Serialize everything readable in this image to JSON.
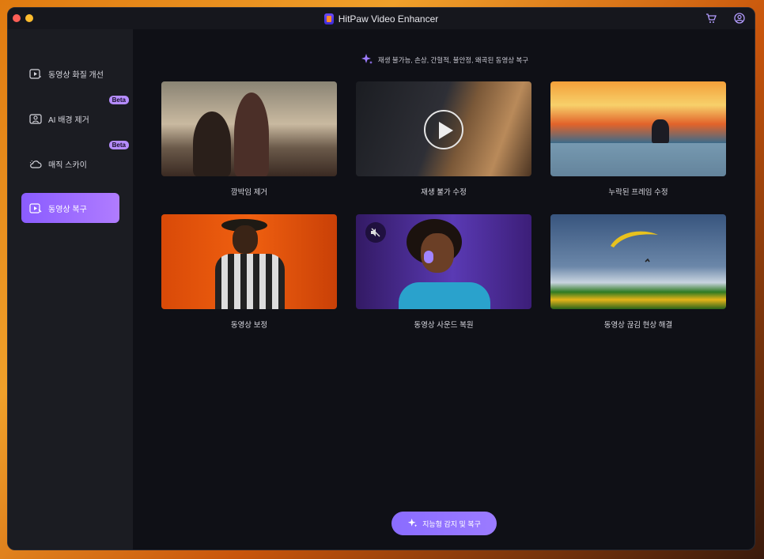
{
  "app": {
    "title": "HitPaw Video Enhancer"
  },
  "sidebar": {
    "items": [
      {
        "label": "동영상 화질 개선",
        "icon": "video-enhance-icon",
        "beta": ""
      },
      {
        "label": "AI 배경 제거",
        "icon": "ai-portrait-icon",
        "beta": "Beta"
      },
      {
        "label": "매직 스카이",
        "icon": "cloud-sky-icon",
        "beta": "Beta"
      },
      {
        "label": "동영상 복구",
        "icon": "video-repair-icon",
        "beta": ""
      }
    ]
  },
  "main": {
    "headline": "재생 불가능, 손상, 간헐적, 불안정, 왜곡된 동영상 복구",
    "cards": [
      {
        "label": "깜박임 제거"
      },
      {
        "label": "재생 불가 수정"
      },
      {
        "label": "누락된 프레임 수정"
      },
      {
        "label": "동영상 보정"
      },
      {
        "label": "동영상 사운드 복원"
      },
      {
        "label": "동영상 끊김 현상 해결"
      }
    ],
    "cta_label": "지능형 감지 및 복구"
  },
  "colors": {
    "accent": "#8a5cff",
    "window_bg": "#0f1016",
    "sidebar_bg": "#1b1c22"
  }
}
